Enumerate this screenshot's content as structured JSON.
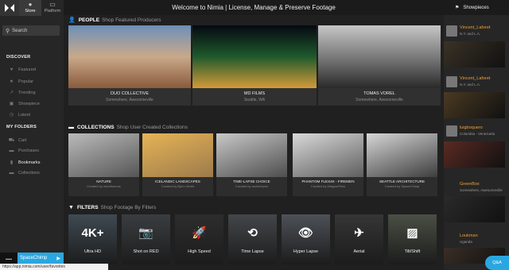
{
  "app": {
    "title": "Welcome to Nimia | License, Manage & Preserve Footage",
    "modes": [
      {
        "label": "Store",
        "icon": "globe-icon",
        "active": true
      },
      {
        "label": "Platform",
        "icon": "monitor-icon",
        "active": false
      }
    ]
  },
  "sidebar": {
    "search_placeholder": "Search",
    "discover_label": "DISCOVER",
    "discover_items": [
      {
        "label": "Featured",
        "icon": "heart-icon"
      },
      {
        "label": "Popular",
        "icon": "star-icon"
      },
      {
        "label": "Trending",
        "icon": "trending-icon"
      },
      {
        "label": "Showpiece",
        "icon": "showpiece-icon"
      },
      {
        "label": "Latest",
        "icon": "clock-icon"
      }
    ],
    "folders_label": "MY FOLDERS",
    "folder_items": [
      {
        "label": "Cart",
        "icon": "cart-icon"
      },
      {
        "label": "Purchases",
        "icon": "folder-icon"
      },
      {
        "label": "Bookmarks",
        "icon": "bookmark-icon"
      },
      {
        "label": "Collections",
        "icon": "folder-icon"
      }
    ],
    "promo_label": "SpaceChimp",
    "status_url": "https://app.nimia.com/user/favorites"
  },
  "people": {
    "title": "PEOPLE",
    "subtitle": "Shop Featured Producers",
    "cards": [
      {
        "name": "DUO COLLECTIVE",
        "location": "Somewhere, Awesomeville",
        "colors": [
          "#6d8fb8",
          "#c9a98a",
          "#8a5a3c"
        ]
      },
      {
        "name": "MD FILMS",
        "location": "Seattle, WA",
        "colors": [
          "#050812",
          "#1f5a2c",
          "#d49a3a"
        ]
      },
      {
        "name": "TOMAS VOREL",
        "location": "Somewhere, Awesomeville",
        "colors": [
          "#c6c6c6",
          "#7a7a7a",
          "#2a2a2a"
        ]
      }
    ]
  },
  "collections": {
    "title": "COLLECTIONS",
    "subtitle": "Shop User Created Collections",
    "cards": [
      {
        "name": "NATURE",
        "by": "Created by mindthomas",
        "colors": [
          "#bbbbbb",
          "#555555"
        ]
      },
      {
        "name": "ICELANDIC LANDSCAPES",
        "by": "Created by Bjorn World",
        "colors": [
          "#e6b456",
          "#9c7a4b"
        ]
      },
      {
        "name": "TIME-LAPSE CHOICE",
        "by": "Created by archiefuzes",
        "colors": [
          "#c8c8c8",
          "#4d4d4d"
        ]
      },
      {
        "name": "PHANTOM FLEX4K - FIREMEN",
        "by": "Created by AtlagasFilms",
        "colors": [
          "#d9d9d9",
          "#5e5e5e"
        ]
      },
      {
        "name": "SEATTLE ARCHITECTURE",
        "by": "Created by SpaceChimp",
        "colors": [
          "#d6d6d6",
          "#3d3d3d"
        ]
      }
    ]
  },
  "filters": {
    "title": "FILTERS",
    "subtitle": "Shop Footage By Filters",
    "items": [
      {
        "label": "Ultra HD",
        "glyph": "4K+",
        "icon": "4k-icon",
        "bg": "#3f4a52"
      },
      {
        "label": "Shot on RED",
        "glyph": "📷",
        "icon": "camera-icon",
        "bg": "#3a3d40"
      },
      {
        "label": "High Speed",
        "glyph": "🚀",
        "icon": "rocket-icon",
        "bg": "#2d2d2d"
      },
      {
        "label": "Time Lapse",
        "glyph": "⟲",
        "icon": "timelapse-icon",
        "bg": "#43464a"
      },
      {
        "label": "Hyper Lapse",
        "glyph": "👁",
        "icon": "eye-icon",
        "bg": "#4d5158"
      },
      {
        "label": "Aerial",
        "glyph": "✈",
        "icon": "plane-icon",
        "bg": "#353535"
      },
      {
        "label": "Tilt/Shift",
        "glyph": "▨",
        "icon": "image-icon",
        "bg": "#4a4f44"
      }
    ]
  },
  "showpieces": {
    "title": "Showpieces",
    "users": [
      {
        "name": "Vincent_Laforet",
        "location": "N.Y. and L.A.",
        "thumb": "#3a3226"
      },
      {
        "name": "Vincent_Laforet",
        "location": "N.Y. and L.A.",
        "thumb": "#4a3a22"
      },
      {
        "name": "luigboquero",
        "location": "Columbia - Venezuela",
        "thumb": "#5a2a22"
      },
      {
        "name": "GreenBox",
        "location": "Somewhere, Awesomeville",
        "thumb": "#2a2a2a"
      },
      {
        "name": "Loukman",
        "location": "Uganda",
        "thumb": "#3a2e26"
      }
    ],
    "qa_label": "Q&A"
  }
}
